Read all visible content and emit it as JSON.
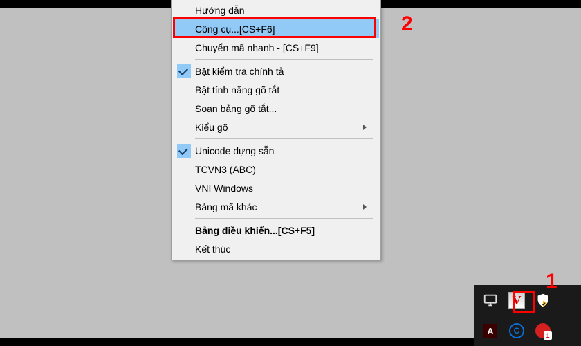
{
  "menu": {
    "huong_dan": "Hướng dẫn",
    "cong_cu": "Công cụ...[CS+F6]",
    "chuyen_ma": "Chuyển mã nhanh - [CS+F9]",
    "bat_kiem_tra": "Bật kiểm tra chính tả",
    "bat_tinh_nang": "Bật tính năng gõ tắt",
    "soan_bang": "Soạn bảng gõ tắt...",
    "kieu_go": "Kiểu gõ",
    "unicode_dung_san": "Unicode dựng sẵn",
    "tcvn3": "TCVN3 (ABC)",
    "vni_windows": "VNI Windows",
    "bang_ma_khac": "Bảng mã khác",
    "bang_dieu_khien": "Bảng điều khiển...[CS+F5]",
    "ket_thuc": "Kết thúc"
  },
  "annotations": {
    "n1": "1",
    "n2": "2"
  },
  "tray": {
    "v_label": "V",
    "adobe_label": "A",
    "copyright_label": "C",
    "badge_label": "1"
  }
}
